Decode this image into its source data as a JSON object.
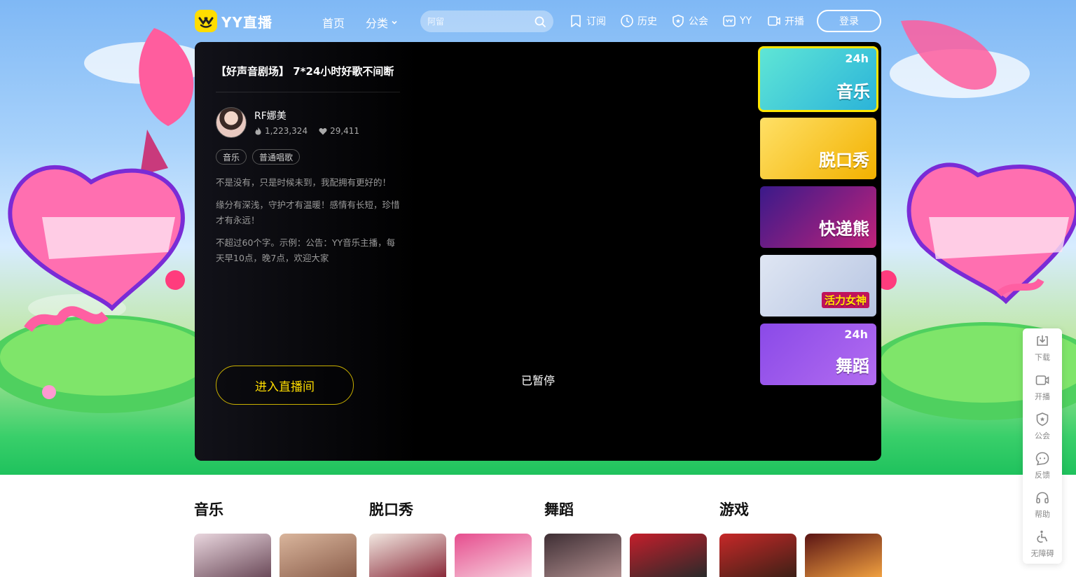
{
  "header": {
    "logo_text": "YY直播",
    "nav": {
      "home": "首页",
      "category": "分类"
    },
    "search": {
      "placeholder": "阿留"
    },
    "links": {
      "subscribe": "订阅",
      "history": "历史",
      "guild": "公会",
      "yy": "YY",
      "broadcast": "开播"
    },
    "login": "登录"
  },
  "player": {
    "room_title": "【好声音剧场】 7*24小时好歌不间断",
    "anchor_name": "RF娜美",
    "heat": "1,223,324",
    "likes": "29,411",
    "tags": [
      "音乐",
      "普通唱歌"
    ],
    "descriptions": [
      "不是没有，只是时候未到，我配拥有更好的！",
      "缘分有深浅，守护才有温暖！感情有长短，珍惜才有永远！",
      "不超过60个字。示例：公告：YY音乐主播，每天早10点，晚7点，欢迎大家"
    ],
    "enter_button": "进入直播间",
    "status": "已暂停"
  },
  "thumbnails": [
    {
      "text": "音乐",
      "badge": "24h",
      "active": true,
      "color_from": "#5fe6d6",
      "color_to": "#2bb3d9"
    },
    {
      "text": "脱口秀",
      "badge": "",
      "active": false,
      "color_from": "#ffe066",
      "color_to": "#f2b100"
    },
    {
      "text": "快递熊",
      "badge": "",
      "active": false,
      "color_from": "#3a1a8a",
      "color_to": "#c0227a"
    },
    {
      "text": "活力女神",
      "badge": "",
      "active": false,
      "color_from": "#dfe6f3",
      "color_to": "#b7c5e2"
    },
    {
      "text": "舞蹈",
      "badge": "24h",
      "active": false,
      "color_from": "#8a4ae8",
      "color_to": "#b36cf0"
    }
  ],
  "float_toolbar": [
    "下载",
    "开播",
    "公会",
    "反馈",
    "帮助",
    "无障碍"
  ],
  "categories": [
    "音乐",
    "脱口秀",
    "舞蹈",
    "游戏"
  ],
  "colors": {
    "accent": "#ffdd00",
    "player_bg": "#000000",
    "header_text": "#ffffff"
  }
}
